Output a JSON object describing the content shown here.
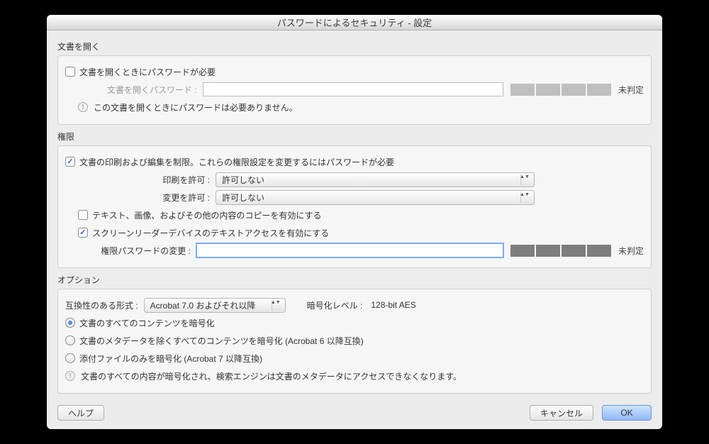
{
  "title": "パスワードによるセキュリティ - 設定",
  "open": {
    "section": "文書を開く",
    "require_checkbox": "文書を開くときにパスワードが必要",
    "password_label": "文書を開くパスワード :",
    "password_value": "",
    "strength_text": "未判定",
    "info": "この文書を開くときにパスワードは必要ありません。"
  },
  "perm": {
    "section": "権限",
    "restrict_checkbox": "文書の印刷および編集を制限。これらの権限設定を変更するにはパスワードが必要",
    "print_label": "印刷を許可 :",
    "print_value": "許可しない",
    "change_label": "変更を許可 :",
    "change_value": "許可しない",
    "copy_checkbox": "テキスト、画像、およびその他の内容のコピーを有効にする",
    "reader_checkbox": "スクリーンリーダーデバイスのテキストアクセスを有効にする",
    "change_pw_label": "権限パスワードの変更 :",
    "change_pw_value": "",
    "strength_text": "未判定"
  },
  "opt": {
    "section": "オプション",
    "compat_label": "互換性のある形式 :",
    "compat_value": "Acrobat 7.0 およびそれ以降",
    "enc_level_label": "暗号化レベル :",
    "enc_level_value": "128-bit AES",
    "r1": "文書のすべてのコンテンツを暗号化",
    "r2": "文書のメタデータを除くすべてのコンテンツを暗号化 (Acrobat 6 以降互換)",
    "r3": "添付ファイルのみを暗号化 (Acrobat 7 以降互換)",
    "info": "文書のすべての内容が暗号化され、検索エンジンは文書のメタデータにアクセスできなくなります。"
  },
  "footer": {
    "help": "ヘルプ",
    "cancel": "キャンセル",
    "ok": "OK"
  }
}
